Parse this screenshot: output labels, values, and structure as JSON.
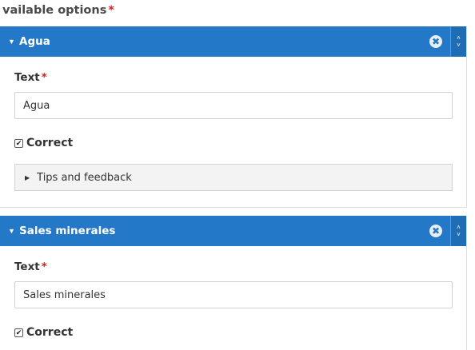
{
  "section": {
    "label": "vailable options",
    "required_mark": "*"
  },
  "options": [
    {
      "title": "Agua",
      "text_label": "Text",
      "text_required": "*",
      "text_value": "Agua",
      "check_mark": "✔",
      "correct_label": "Correct",
      "correct_checked": true,
      "tips_label": "Tips and feedback",
      "remove_icon": "✖",
      "order_up": "˄",
      "order_down": "˅",
      "caret": "▼"
    },
    {
      "title": "Sales minerales",
      "text_label": "Text",
      "text_required": "*",
      "text_value": "Sales minerales",
      "check_mark": "✔",
      "correct_label": "Correct",
      "correct_checked": true,
      "remove_icon": "✖",
      "order_up": "˄",
      "order_down": "˅",
      "caret": "▼"
    }
  ],
  "tips_caret": "▶",
  "colors": {
    "header": "#2378c7",
    "required": "#d42020"
  }
}
